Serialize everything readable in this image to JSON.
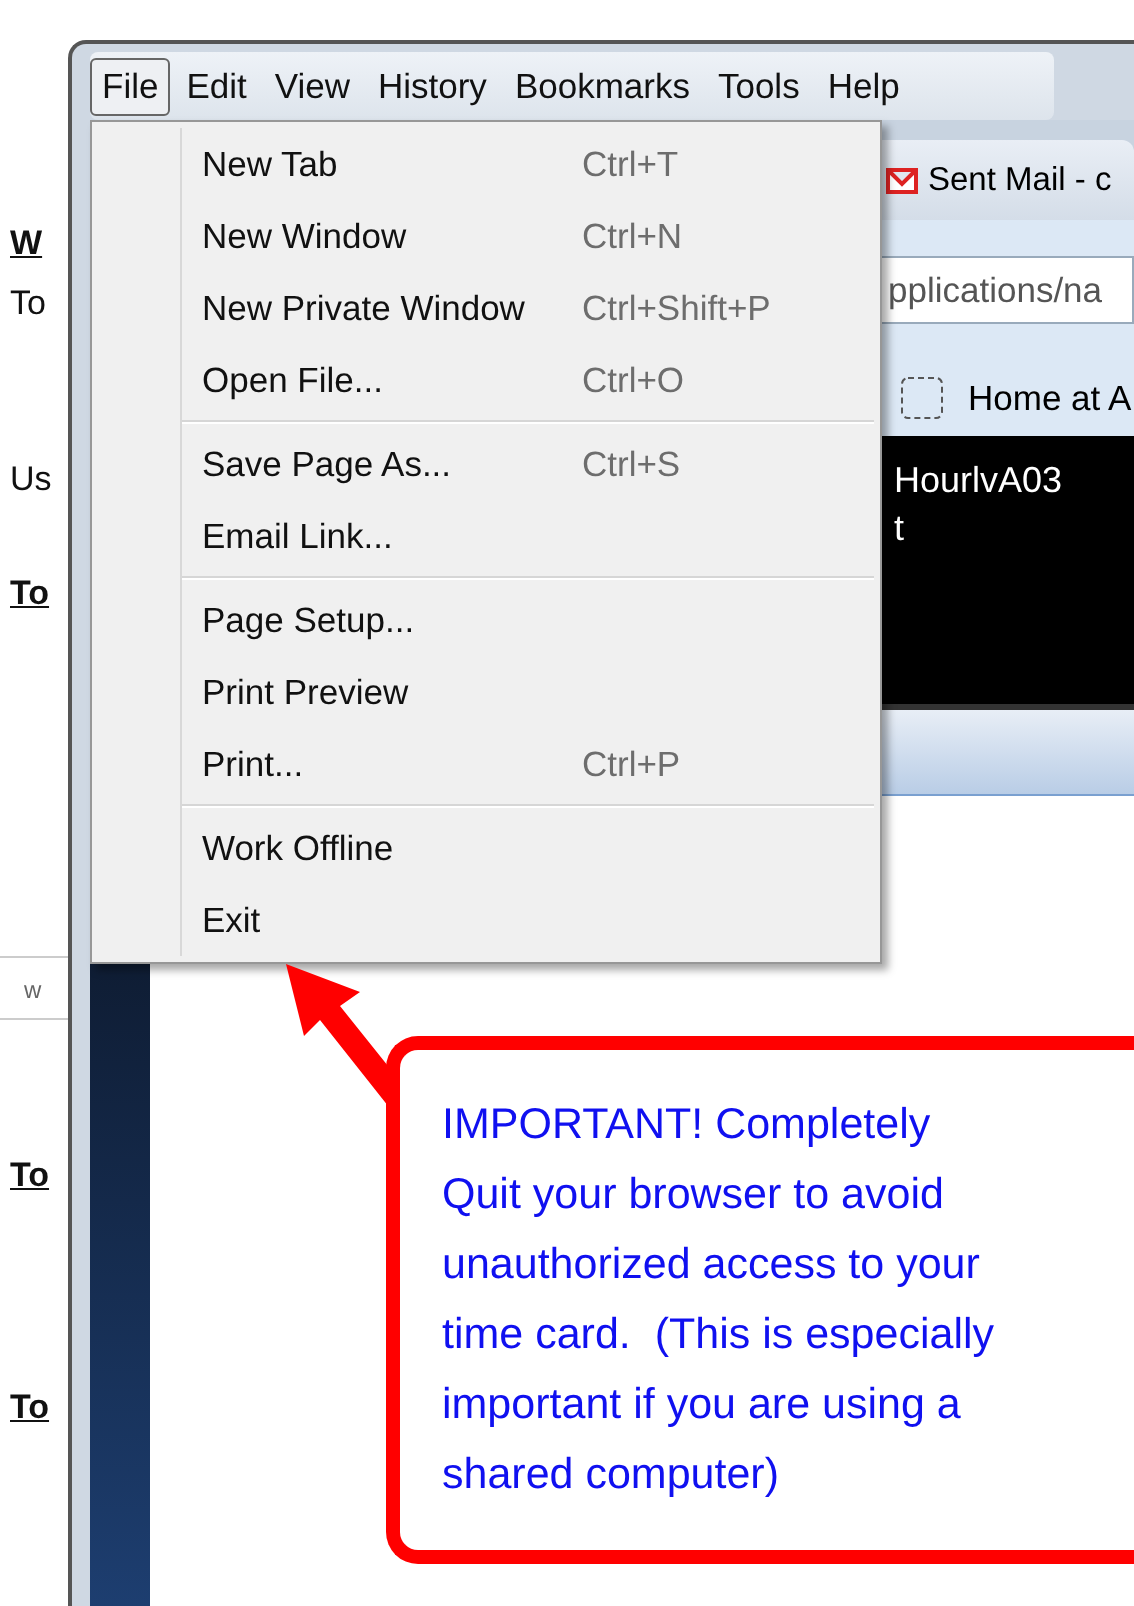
{
  "background_page": {
    "texts": [
      {
        "text": "W",
        "kind": "link"
      },
      {
        "text": "To",
        "kind": "plain"
      },
      {
        "text": "Us",
        "kind": "plain"
      },
      {
        "text": "To",
        "kind": "link"
      },
      {
        "text": "w",
        "kind": "field"
      },
      {
        "text": "To",
        "kind": "link"
      },
      {
        "text": "To",
        "kind": "link"
      }
    ]
  },
  "menu_bar": [
    {
      "label": "File",
      "selected": true
    },
    {
      "label": "Edit",
      "selected": false
    },
    {
      "label": "View",
      "selected": false
    },
    {
      "label": "History",
      "selected": false
    },
    {
      "label": "Bookmarks",
      "selected": false
    },
    {
      "label": "Tools",
      "selected": false
    },
    {
      "label": "Help",
      "selected": false
    }
  ],
  "file_menu": {
    "groups": [
      [
        {
          "label": "New Tab",
          "shortcut": "Ctrl+T"
        },
        {
          "label": "New Window",
          "shortcut": "Ctrl+N"
        },
        {
          "label": "New Private Window",
          "shortcut": "Ctrl+Shift+P"
        },
        {
          "label": "Open File...",
          "shortcut": "Ctrl+O"
        }
      ],
      [
        {
          "label": "Save Page As...",
          "shortcut": "Ctrl+S"
        },
        {
          "label": "Email Link..."
        }
      ],
      [
        {
          "label": "Page Setup..."
        },
        {
          "label": "Print Preview"
        },
        {
          "label": "Print...",
          "shortcut": "Ctrl+P"
        }
      ],
      [
        {
          "label": "Work Offline"
        },
        {
          "label": "Exit"
        }
      ]
    ]
  },
  "browser": {
    "tab_title": "Sent Mail - c",
    "address": "pplications/na",
    "bookmark": "Home at A",
    "banner_lines": [
      "HourlvA03",
      "t"
    ]
  },
  "callout": {
    "text": "IMPORTANT! Completely\nQuit your browser to avoid\nunauthorized access to your\ntime card.  (This is especially\nimportant if you are using a\nshared computer)"
  }
}
